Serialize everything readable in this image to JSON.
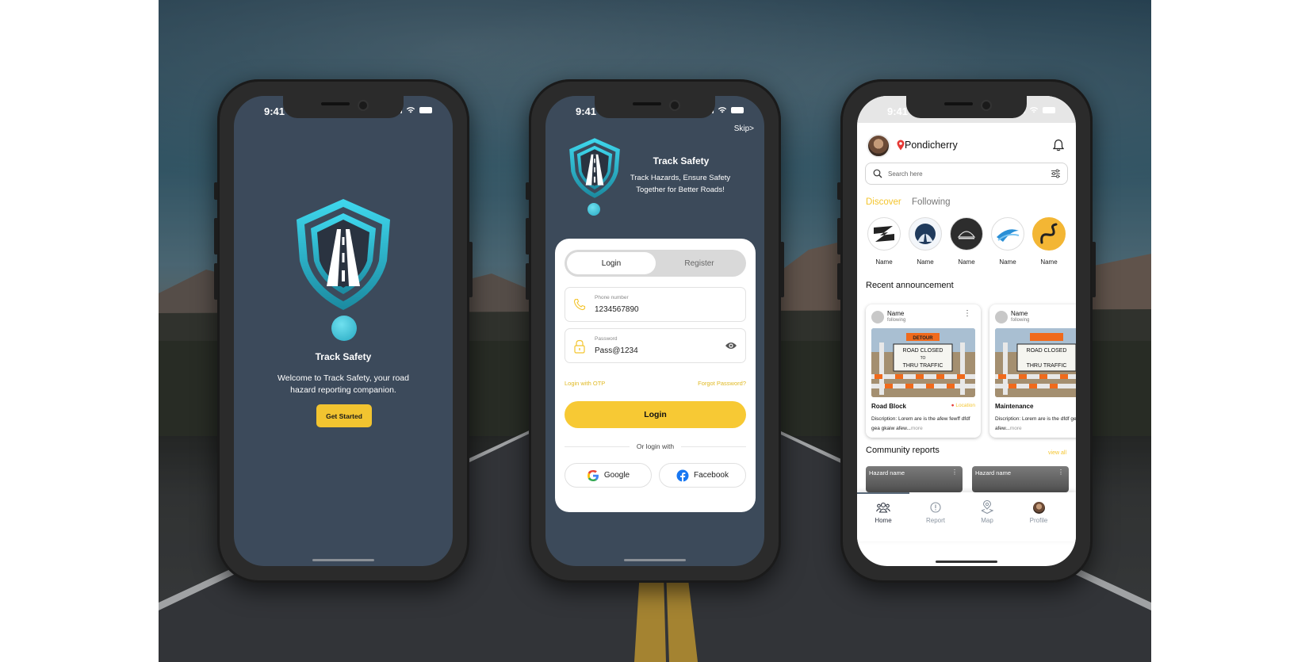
{
  "status": {
    "time": "9:41"
  },
  "brand": {
    "name": "Track Safety",
    "color": "#2bbfd6"
  },
  "welcome": {
    "title": "Track Safety",
    "description": "Welcome to Track Safety, your road hazard reporting companion.",
    "cta": "Get Started"
  },
  "login": {
    "skip": "Skip>",
    "title": "Track Safety",
    "tagline": "Track Hazards, Ensure Safety Together for Better Roads!",
    "tabs": [
      "Login",
      "Register"
    ],
    "phone": {
      "label": "Phone number",
      "value": "1234567890"
    },
    "password": {
      "label": "Password",
      "value": "Pass@1234"
    },
    "otp_link": "Login with OTP",
    "forgot_link": "Forgot Password?",
    "submit": "Login",
    "or_with": "Or login with",
    "google": "Google",
    "facebook": "Facebook"
  },
  "home": {
    "location": "Pondicherry",
    "search_placeholder": "Search here",
    "tabs": {
      "discover": "Discover",
      "following": "Following"
    },
    "channels": [
      "Name",
      "Name",
      "Name",
      "Name",
      "Name"
    ],
    "recent_title": "Recent announcement",
    "announcements": [
      {
        "name": "Name",
        "status": "following",
        "title": "Road Block",
        "location": "Location",
        "desc": "Discription: Lorem are is the afew fewff dfdf gea gkaiw afew...",
        "more": "more"
      },
      {
        "name": "Name",
        "status": "following",
        "title": "Maintenance",
        "location": "",
        "desc": "Discription: Lorem are is the dfdf gea gkaiw afew...",
        "more": "more"
      }
    ],
    "sign_text": {
      "top": "DETOUR",
      "line1": "ROAD CLOSED",
      "line2": "TO",
      "line3": "THRU TRAFFIC"
    },
    "community_title": "Community reports",
    "view_all": "view all",
    "reports": [
      "Hazard name",
      "Hazard name"
    ],
    "nav": [
      "Home",
      "Report",
      "Map",
      "Profile"
    ]
  },
  "colors": {
    "accent": "#f4c52e",
    "screen_dark": "#3c4a5b",
    "teal": "#2bbfd6"
  }
}
